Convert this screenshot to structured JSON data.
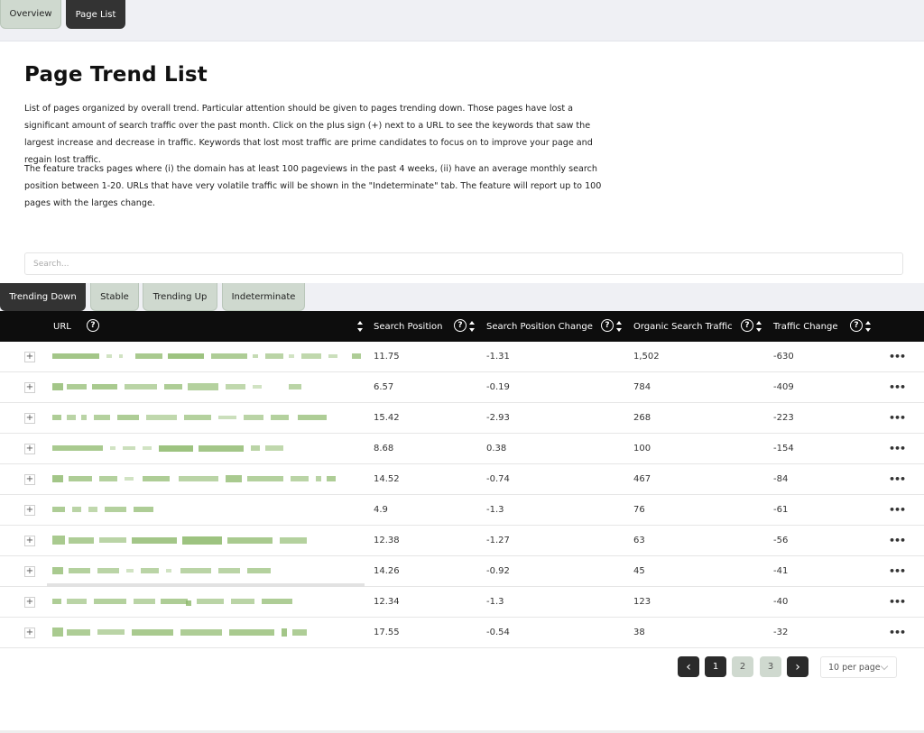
{
  "nav_tabs": [
    {
      "label": "Overview",
      "active": false
    },
    {
      "label": "Page List",
      "active": true
    }
  ],
  "page": {
    "title": "Page Trend List",
    "description_1": "List of pages organized by overall trend. Particular attention should be given to pages trending down. Those pages have lost a significant amount of search traffic over the past month. Click on the plus sign (+) next to a URL to see the keywords that saw the largest increase and decrease in traffic. Keywords that lost most traffic are prime candidates to focus on to improve your page and regain lost traffic.",
    "description_2": "The feature tracks pages where (i) the domain has at least 100 pageviews in the past 4 weeks, (ii) have an average monthly search position between 1-20. URLs that have very volatile traffic will be shown in the \"Indeterminate\" tab. The feature will report up to 100 pages with the larges change."
  },
  "search": {
    "placeholder": "Search...",
    "value": ""
  },
  "trend_tabs": [
    {
      "label": "Trending Down",
      "active": true
    },
    {
      "label": "Stable",
      "active": false
    },
    {
      "label": "Trending Up",
      "active": false
    },
    {
      "label": "Indeterminate",
      "active": false
    }
  ],
  "table": {
    "columns": {
      "url": "URL",
      "search_position": "Search Position",
      "search_position_change": "Search Position Change",
      "organic_search_traffic": "Organic Search Traffic",
      "traffic_change": "Traffic Change"
    },
    "help_glyph": "?",
    "expand_glyph": "+",
    "more_glyph": "•••",
    "rows": [
      {
        "position": "11.75",
        "position_change": "-1.31",
        "traffic": "1,502",
        "traffic_change": "-630"
      },
      {
        "position": "6.57",
        "position_change": "-0.19",
        "traffic": "784",
        "traffic_change": "-409"
      },
      {
        "position": "15.42",
        "position_change": "-2.93",
        "traffic": "268",
        "traffic_change": "-223"
      },
      {
        "position": "8.68",
        "position_change": "0.38",
        "traffic": "100",
        "traffic_change": "-154"
      },
      {
        "position": "14.52",
        "position_change": "-0.74",
        "traffic": "467",
        "traffic_change": "-84"
      },
      {
        "position": "4.9",
        "position_change": "-1.3",
        "traffic": "76",
        "traffic_change": "-61"
      },
      {
        "position": "12.38",
        "position_change": "-1.27",
        "traffic": "63",
        "traffic_change": "-56"
      },
      {
        "position": "14.26",
        "position_change": "-0.92",
        "traffic": "45",
        "traffic_change": "-41"
      },
      {
        "position": "12.34",
        "position_change": "-1.3",
        "traffic": "123",
        "traffic_change": "-40"
      },
      {
        "position": "17.55",
        "position_change": "-0.54",
        "traffic": "38",
        "traffic_change": "-32"
      }
    ]
  },
  "pagination": {
    "prev": "‹",
    "next": "›",
    "pages": [
      "1",
      "2",
      "3"
    ],
    "current": "1",
    "per_page": "10 per page"
  },
  "colors": {
    "header_bg": "#0d0d0d",
    "active_tab": "#333333",
    "inactive_tab": "#cfd9cf",
    "blur_green": "#7fae5a"
  }
}
